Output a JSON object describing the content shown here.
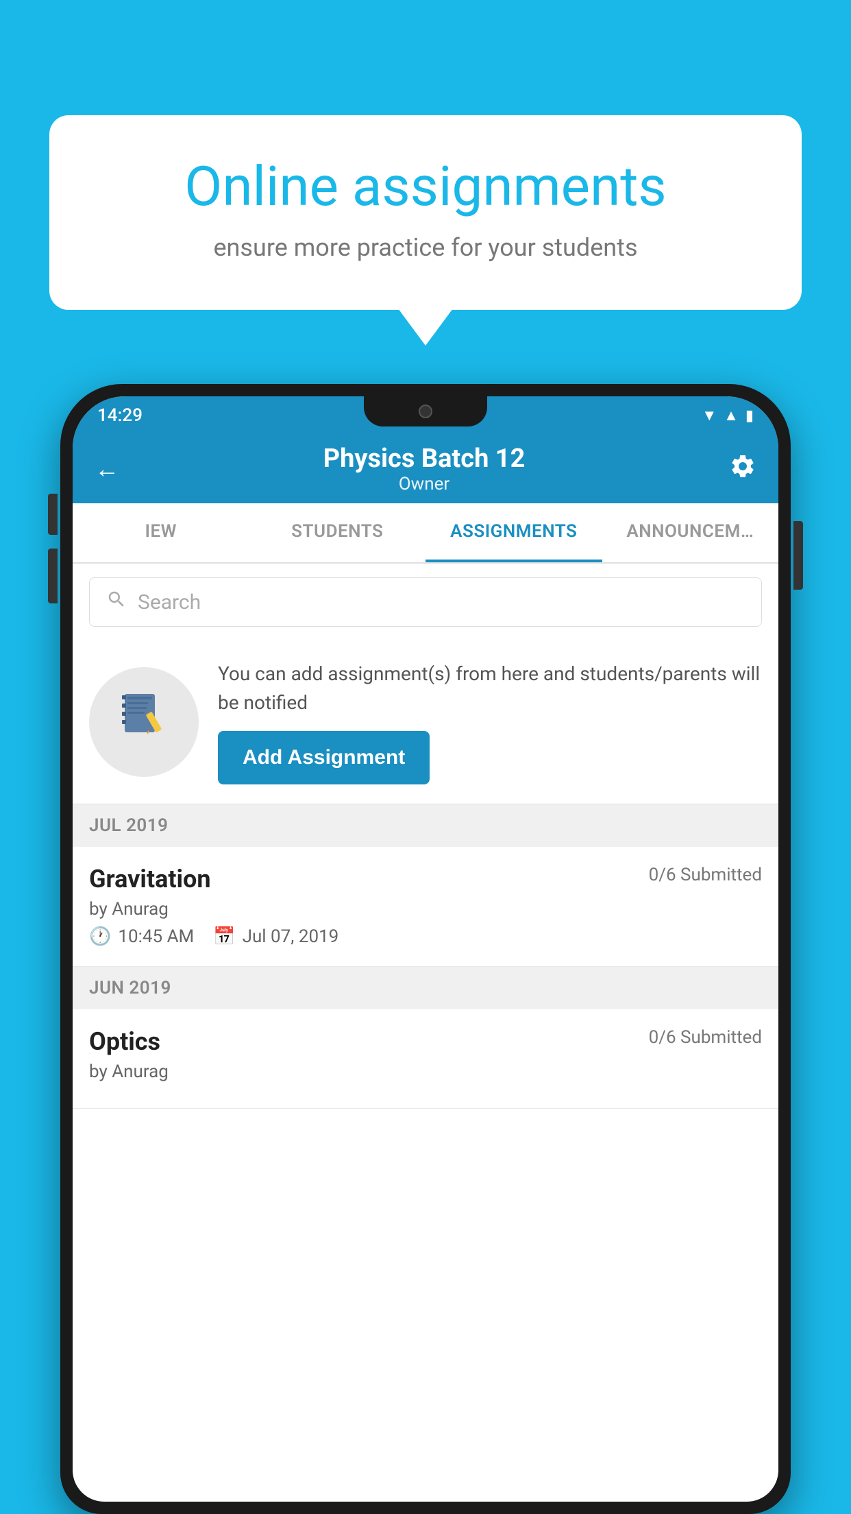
{
  "background_color": "#1ab8e8",
  "speech_bubble": {
    "title": "Online assignments",
    "subtitle": "ensure more practice for your students"
  },
  "phone": {
    "status_bar": {
      "time": "14:29",
      "icons": [
        "wifi",
        "signal",
        "battery"
      ]
    },
    "header": {
      "back_label": "←",
      "title": "Physics Batch 12",
      "subtitle": "Owner",
      "settings_label": "⚙"
    },
    "tabs": [
      {
        "label": "IEW",
        "active": false
      },
      {
        "label": "STUDENTS",
        "active": false
      },
      {
        "label": "ASSIGNMENTS",
        "active": true
      },
      {
        "label": "ANNOUNCEM…",
        "active": false
      }
    ],
    "search": {
      "placeholder": "Search"
    },
    "promo": {
      "description": "You can add assignment(s) from here and students/parents will be notified",
      "button_label": "Add Assignment"
    },
    "sections": [
      {
        "label": "JUL 2019",
        "assignments": [
          {
            "title": "Gravitation",
            "submitted": "0/6 Submitted",
            "by": "by Anurag",
            "time": "10:45 AM",
            "date": "Jul 07, 2019"
          }
        ]
      },
      {
        "label": "JUN 2019",
        "assignments": [
          {
            "title": "Optics",
            "submitted": "0/6 Submitted",
            "by": "by Anurag",
            "time": "",
            "date": ""
          }
        ]
      }
    ]
  }
}
